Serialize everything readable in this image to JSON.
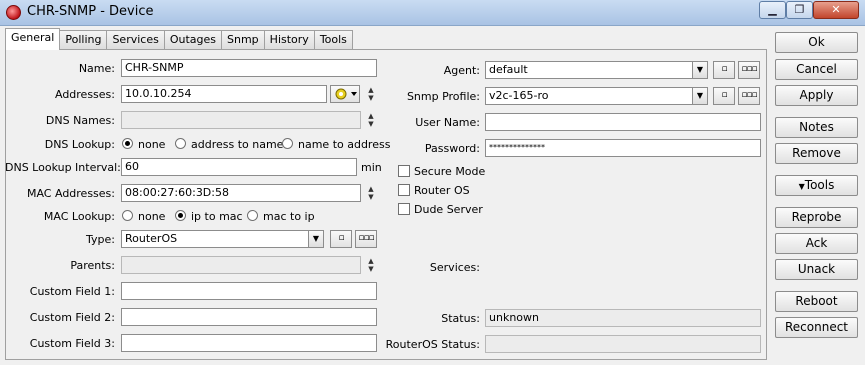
{
  "window": {
    "title": "CHR-SNMP - Device",
    "minimize": "▁",
    "restore": "❐",
    "close": "✕"
  },
  "tabs": [
    "General",
    "Polling",
    "Services",
    "Outages",
    "Snmp",
    "History",
    "Tools"
  ],
  "general": {
    "name": {
      "label": "Name:",
      "value": "CHR-SNMP"
    },
    "addresses": {
      "label": "Addresses:",
      "value": "10.0.10.254"
    },
    "dns_names": {
      "label": "DNS Names:",
      "value": ""
    },
    "dns_lookup": {
      "label": "DNS Lookup:",
      "options": [
        "none",
        "address to name",
        "name to address"
      ],
      "selected": "none"
    },
    "dns_lookup_interval": {
      "label": "DNS Lookup Interval:",
      "value": "60",
      "unit": "min"
    },
    "mac_addresses": {
      "label": "MAC Addresses:",
      "value": "08:00:27:60:3D:58"
    },
    "mac_lookup": {
      "label": "MAC Lookup:",
      "options": [
        "none",
        "ip to mac",
        "mac to ip"
      ],
      "selected": "ip to mac"
    },
    "type": {
      "label": "Type:",
      "value": "RouterOS"
    },
    "parents": {
      "label": "Parents:",
      "value": ""
    },
    "custom_field_1": {
      "label": "Custom Field 1:",
      "value": ""
    },
    "custom_field_2": {
      "label": "Custom Field 2:",
      "value": ""
    },
    "custom_field_3": {
      "label": "Custom Field 3:",
      "value": ""
    },
    "agent": {
      "label": "Agent:",
      "value": "default"
    },
    "snmp_profile": {
      "label": "Snmp Profile:",
      "value": "v2c-165-ro"
    },
    "user_name": {
      "label": "User Name:",
      "value": ""
    },
    "password": {
      "label": "Password:",
      "value": "**************"
    },
    "checkboxes": {
      "secure_mode": "Secure Mode",
      "router_os": "Router OS",
      "dude_server": "Dude Server"
    },
    "services": {
      "label": "Services:"
    },
    "status": {
      "label": "Status:",
      "value": "unknown"
    },
    "routeros_status": {
      "label": "RouterOS Status:",
      "value": ""
    }
  },
  "buttons": {
    "ok": "Ok",
    "cancel": "Cancel",
    "apply": "Apply",
    "notes": "Notes",
    "remove": "Remove",
    "tools": "Tools",
    "reprobe": "Reprobe",
    "ack": "Ack",
    "unack": "Unack",
    "reboot": "Reboot",
    "reconnect": "Reconnect"
  },
  "glyphs": {
    "dropdown": "▼",
    "up": "▲",
    "down": "▼",
    "small_square": "▫",
    "three_squares": "▫▫▫"
  },
  "colors": {
    "title_bar": "#b9d1ee",
    "close_button": "#c2452c",
    "field_bg": "#ffffff"
  }
}
